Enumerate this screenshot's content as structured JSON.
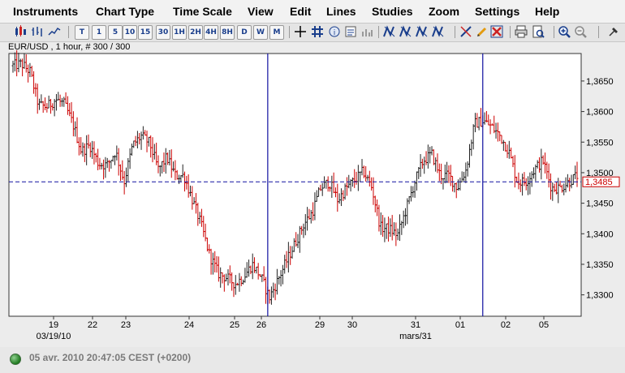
{
  "menu": [
    "Instruments",
    "Chart Type",
    "Time Scale",
    "View",
    "Edit",
    "Lines",
    "Studies",
    "Zoom",
    "Settings",
    "Help"
  ],
  "toolbar": {
    "timescale_buttons": [
      "T",
      "1",
      "5",
      "10",
      "15",
      "30",
      "1H",
      "2H",
      "4H",
      "8H",
      "D",
      "W",
      "M"
    ],
    "icons": [
      "candlestick-chart-icon",
      "bar-chart-icon",
      "line-chart-icon",
      "crosshair-icon",
      "grid-icon",
      "info-icon",
      "settings-icon",
      "volume-icon",
      "draw-line-icon",
      "draw-line-icon",
      "draw-line-icon",
      "draw-line-icon",
      "draw-line-icon",
      "pencil-icon",
      "eraser-icon",
      "delete-icon",
      "print-icon",
      "print-preview-icon",
      "zoom-in-icon",
      "zoom-out-icon",
      "pin-icon"
    ]
  },
  "chart": {
    "title": "EUR/USD , 1 hour, # 300 / 300",
    "current_price": "1,3485",
    "colors": {
      "up": "#222222",
      "down": "#cc0000",
      "vline": "#1010a0",
      "hline": "#1010a0",
      "price_label": "#cc0000"
    }
  },
  "chart_data": {
    "type": "bar",
    "title": "EUR/USD , 1 hour, # 300 / 300",
    "y_ticks": [
      "1,3650",
      "1,3600",
      "1,3550",
      "1,3500",
      "1,3450",
      "1,3400",
      "1,3350",
      "1,3300"
    ],
    "x_ticks": [
      "19",
      "22",
      "23",
      "24",
      "25",
      "26",
      "29",
      "30",
      "31",
      "01",
      "02",
      "05"
    ],
    "x_subticks": [
      "03/19/10",
      "mars/31"
    ],
    "ylim": [
      1.3265,
      1.3695
    ],
    "current_price": 1.3485,
    "price_path": [
      [
        0,
        1.3675
      ],
      [
        0.02,
        1.3678
      ],
      [
        0.04,
        1.3665
      ],
      [
        0.06,
        1.361
      ],
      [
        0.08,
        1.3608
      ],
      [
        0.1,
        1.362
      ],
      [
        0.12,
        1.3612
      ],
      [
        0.14,
        1.358
      ],
      [
        0.16,
        1.3535
      ],
      [
        0.18,
        1.3545
      ],
      [
        0.2,
        1.3515
      ],
      [
        0.22,
        1.3512
      ],
      [
        0.24,
        1.3535
      ],
      [
        0.26,
        1.3485
      ],
      [
        0.28,
        1.3545
      ],
      [
        0.3,
        1.356
      ],
      [
        0.32,
        1.3548
      ],
      [
        0.34,
        1.3505
      ],
      [
        0.36,
        1.3525
      ],
      [
        0.38,
        1.3495
      ],
      [
        0.4,
        1.3495
      ],
      [
        0.42,
        1.3455
      ],
      [
        0.44,
        1.3415
      ],
      [
        0.46,
        1.3365
      ],
      [
        0.48,
        1.3335
      ],
      [
        0.5,
        1.3328
      ],
      [
        0.52,
        1.3318
      ],
      [
        0.54,
        1.333
      ],
      [
        0.56,
        1.335
      ],
      [
        0.58,
        1.333
      ],
      [
        0.6,
        1.3295
      ],
      [
        0.62,
        1.3325
      ],
      [
        0.64,
        1.3355
      ],
      [
        0.66,
        1.3385
      ],
      [
        0.68,
        1.3415
      ],
      [
        0.7,
        1.3435
      ],
      [
        0.72,
        1.3475
      ],
      [
        0.74,
        1.3485
      ],
      [
        0.76,
        1.3455
      ],
      [
        0.78,
        1.3475
      ],
      [
        0.8,
        1.3488
      ],
      [
        0.82,
        1.3502
      ],
      [
        0.84,
        1.3475
      ],
      [
        0.86,
        1.341
      ],
      [
        0.88,
        1.3408
      ],
      [
        0.9,
        1.3398
      ],
      [
        0.92,
        1.344
      ],
      [
        0.94,
        1.3485
      ],
      [
        0.96,
        1.352
      ],
      [
        0.98,
        1.353
      ],
      [
        1.0,
        1.3495
      ],
      [
        1.02,
        1.3495
      ],
      [
        1.04,
        1.3475
      ],
      [
        1.06,
        1.3505
      ],
      [
        1.08,
        1.358
      ],
      [
        1.1,
        1.3585
      ],
      [
        1.12,
        1.3575
      ],
      [
        1.14,
        1.356
      ],
      [
        1.16,
        1.3535
      ],
      [
        1.18,
        1.3485
      ],
      [
        1.2,
        1.3485
      ],
      [
        1.22,
        1.3505
      ],
      [
        1.24,
        1.352
      ],
      [
        1.26,
        1.3475
      ],
      [
        1.28,
        1.3475
      ],
      [
        1.3,
        1.3485
      ],
      [
        1.32,
        1.3495
      ]
    ],
    "vertical_markers_x": [
      0.597,
      1.093
    ]
  },
  "status": {
    "text": "05 avr. 2010 20:47:05  CEST (+0200)"
  }
}
